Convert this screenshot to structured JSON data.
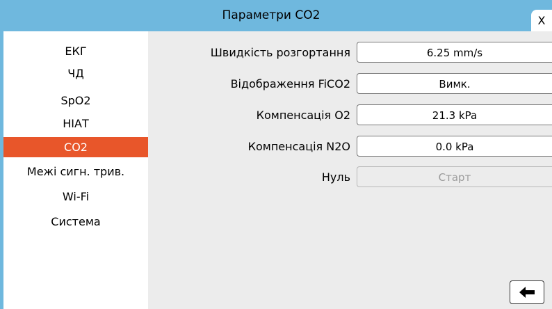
{
  "header": {
    "title": "Параметри CO2",
    "close_label": "X"
  },
  "sidebar": {
    "items": [
      {
        "label": "ЕКГ",
        "active": false
      },
      {
        "label": "ЧД",
        "active": false
      },
      {
        "label": "SpO2",
        "active": false
      },
      {
        "label": "НІАТ",
        "active": false
      },
      {
        "label": "CO2",
        "active": true
      },
      {
        "label": "Межі сигн. трив.",
        "active": false
      },
      {
        "label": "Wi-Fi",
        "active": false
      },
      {
        "label": "Система",
        "active": false
      }
    ]
  },
  "settings": {
    "sweep_speed": {
      "label": "Швидкість розгортання",
      "value": "6.25 mm/s"
    },
    "fico2_display": {
      "label": "Відображення FiCO2",
      "value": "Вимк."
    },
    "o2_compensation": {
      "label": "Компенсація O2",
      "value": "21.3 kPa"
    },
    "n2o_compensation": {
      "label": "Компенсація N2O",
      "value": "0.0 kPa"
    },
    "zero": {
      "label": "Нуль",
      "value": "Старт",
      "disabled": true
    }
  },
  "footer": {
    "back_icon": "left-arrow-icon"
  },
  "colors": {
    "header": "#6fb8de",
    "active_item": "#e8562a",
    "panel": "#ececec"
  }
}
